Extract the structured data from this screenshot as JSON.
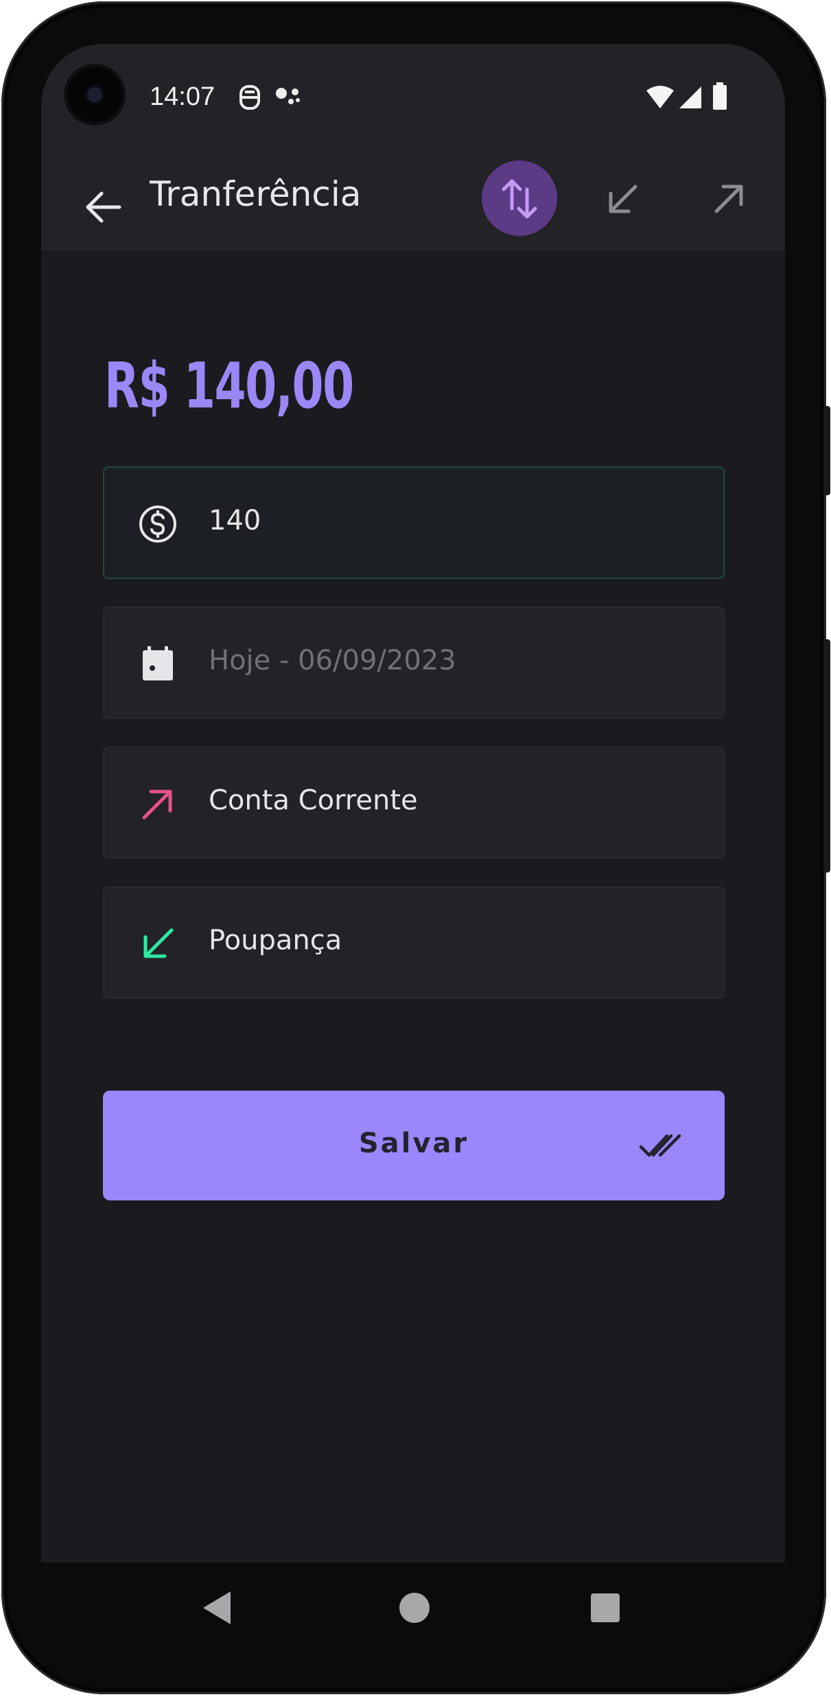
{
  "status_bar": {
    "time": "14:07"
  },
  "app_bar": {
    "title": "Tranferência",
    "selected_mode": "transfer"
  },
  "amount_display": "R$ 140,00",
  "fields": {
    "value": {
      "text": "140",
      "icon": "dollar-circle-icon"
    },
    "date": {
      "placeholder": "Hoje - 06/09/2023",
      "icon": "calendar-icon"
    },
    "source_account": {
      "text": "Conta Corrente",
      "icon": "arrow-up-right-icon"
    },
    "destination_account": {
      "text": "Poupança",
      "icon": "arrow-down-left-icon"
    }
  },
  "save_button": {
    "label": "Salvar",
    "icon": "double-check-icon"
  },
  "colors": {
    "accent": "#9b87fb",
    "outgoing": "#e9508a",
    "incoming": "#2ee8a4",
    "background": "#1b1b1f"
  }
}
